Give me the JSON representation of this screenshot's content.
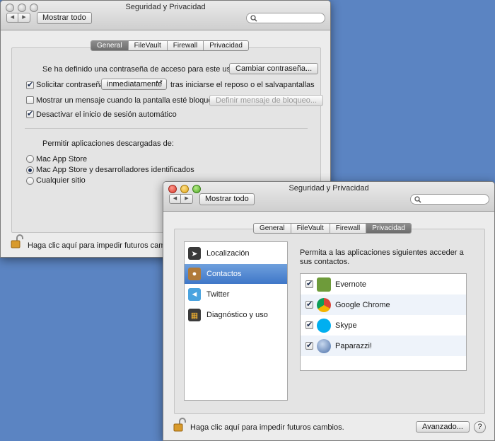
{
  "window1": {
    "title": "Seguridad y Privacidad",
    "show_all": "Mostrar todo",
    "tabs": [
      "General",
      "FileVault",
      "Firewall",
      "Privacidad"
    ],
    "active_tab": "General",
    "password_set_text": "Se ha definido una contraseña de acceso para este usuario",
    "change_password_button": "Cambiar contraseña...",
    "require_password_label": "Solicitar contraseña",
    "require_password_value": "inmediatamente",
    "require_password_suffix": "tras iniciarse el reposo o el salvapantallas",
    "show_message_label": "Mostrar un mensaje cuando la pantalla esté bloqueada",
    "set_lock_message_button": "Definir mensaje de bloqueo...",
    "disable_autologin_label": "Desactivar el inicio de sesión automático",
    "allow_apps_heading": "Permitir aplicaciones descargadas de:",
    "radio_options": [
      "Mac App Store",
      "Mac App Store y desarrolladores identificados",
      "Cualquier sitio"
    ],
    "selected_radio": "Mac App Store y desarrolladores identificados",
    "lock_text": "Haga clic aquí para impedir futuros cambios."
  },
  "window2": {
    "title": "Seguridad y Privacidad",
    "show_all": "Mostrar todo",
    "tabs": [
      "General",
      "FileVault",
      "Firewall",
      "Privacidad"
    ],
    "active_tab": "Privacidad",
    "sidebar_items": [
      "Localización",
      "Contactos",
      "Twitter",
      "Diagnóstico y uso"
    ],
    "selected_sidebar": "Contactos",
    "apps_heading": "Permita a las aplicaciones siguientes acceder a sus contactos.",
    "apps": [
      "Evernote",
      "Google Chrome",
      "Skype",
      "Paparazzi!"
    ],
    "lock_text": "Haga clic aquí para impedir futuros cambios.",
    "advanced_button": "Avanzado...",
    "help_button": "?"
  },
  "colors": {
    "desktop": "#5b84c2",
    "selection": "#3f77c8"
  }
}
